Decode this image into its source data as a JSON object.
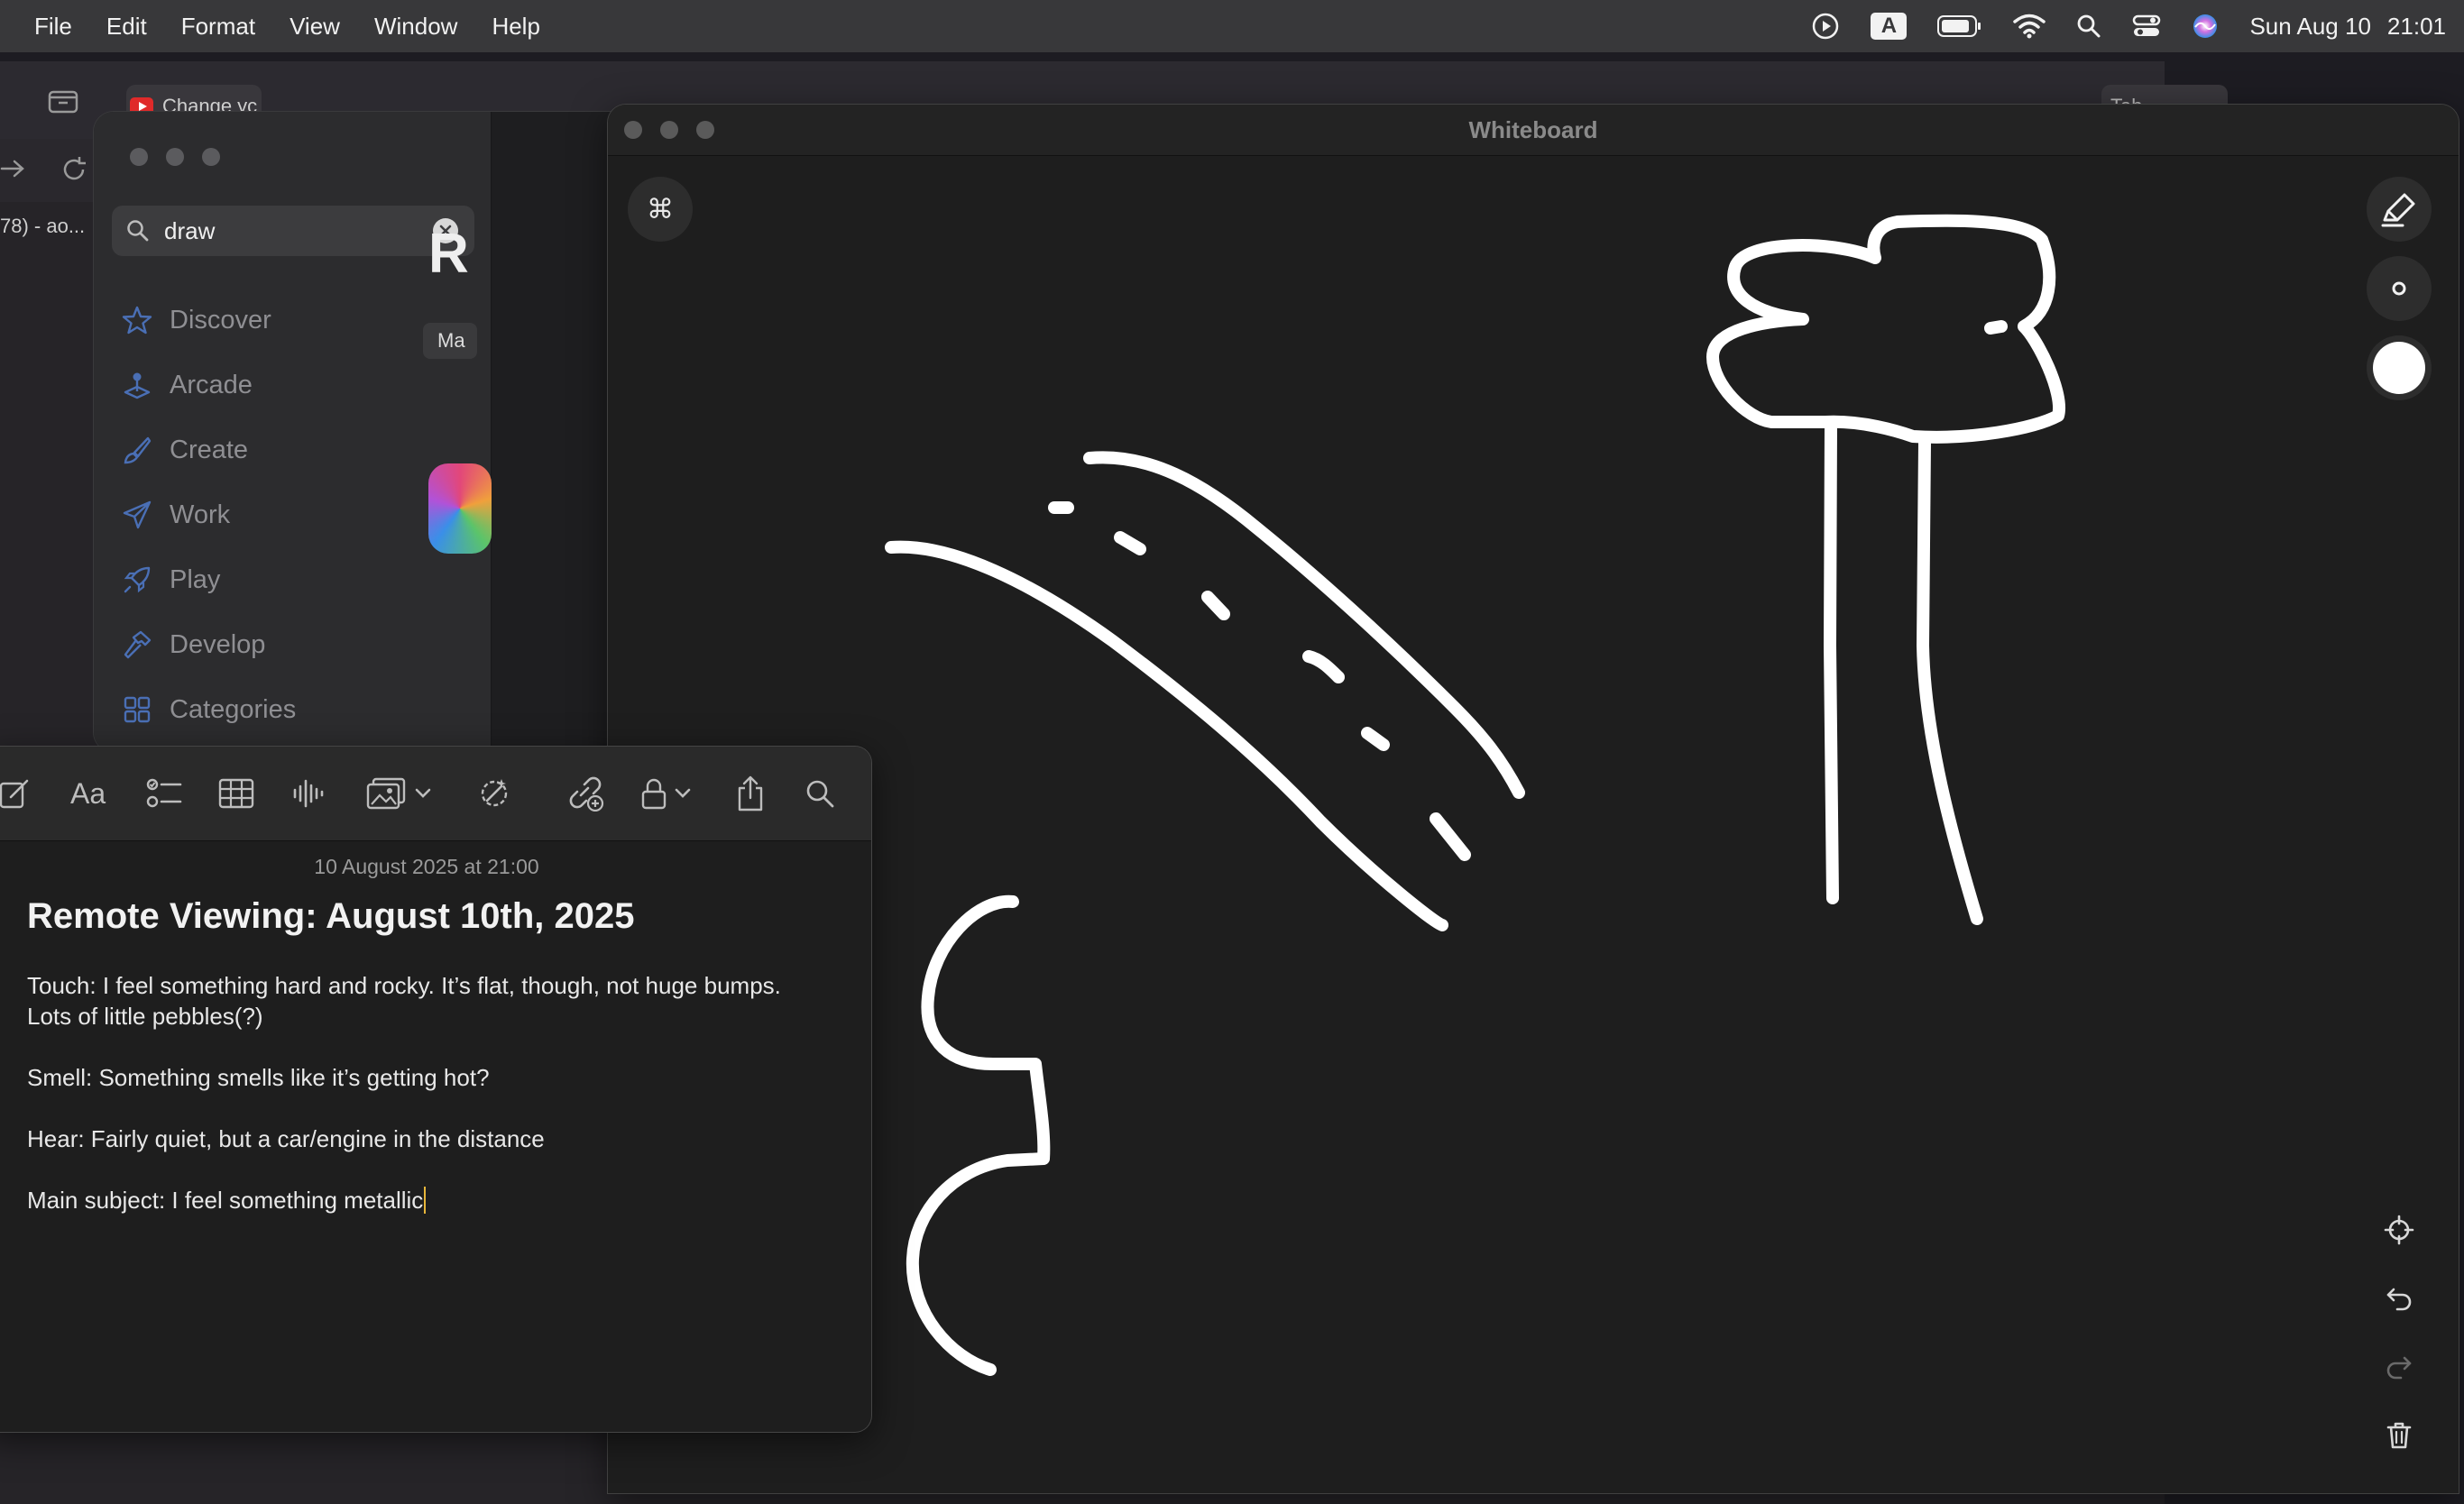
{
  "menubar": {
    "items": [
      "File",
      "Edit",
      "Format",
      "View",
      "Window",
      "Help"
    ],
    "input_source": "A",
    "clock": {
      "date": "Sun Aug 10",
      "time": "21:01"
    }
  },
  "browser": {
    "tab_title": "Change yc",
    "right_tab_title": "Tab",
    "sidebar_tab_text": "78) - ao..."
  },
  "appstore": {
    "search": {
      "value": "draw"
    },
    "nav": [
      {
        "label": "Discover",
        "icon": "star-icon"
      },
      {
        "label": "Arcade",
        "icon": "joystick-icon"
      },
      {
        "label": "Create",
        "icon": "brush-icon"
      },
      {
        "label": "Work",
        "icon": "paperplane-icon"
      },
      {
        "label": "Play",
        "icon": "rocket-icon"
      },
      {
        "label": "Develop",
        "icon": "hammer-icon"
      },
      {
        "label": "Categories",
        "icon": "grid-icon"
      }
    ],
    "main_heading_partial": "R",
    "main_pill_partial": "Ma"
  },
  "whiteboard": {
    "title": "Whiteboard",
    "command_icon": "⌘",
    "pen_color": "#ffffff",
    "tools": [
      "highlighter-icon",
      "brush-size-icon",
      "color-swatch-icon"
    ],
    "bottom_tools": [
      "recenter-icon",
      "undo-icon",
      "redo-icon",
      "trash-icon"
    ]
  },
  "notes": {
    "date": "10 August 2025 at 21:00",
    "title": "Remote Viewing: August 10th, 2025",
    "lines": [
      "Touch: I feel something hard and rocky. It’s flat, though, not huge bumps.",
      "Lots of little pebbles(?)",
      "Smell: Something smells like it’s getting hot?",
      "Hear: Fairly quiet, but a car/engine in the distance",
      "Main subject: I feel something metallic"
    ],
    "caret_color": "#e7b63a",
    "toolbar_items": [
      "compose-icon",
      "text-format-icon",
      "checklist-icon",
      "table-icon",
      "audio-icon",
      "media-icon",
      "chevron-down-icon",
      "writing-tools-icon",
      "collaborate-icon",
      "lock-icon",
      "chevron-down-icon",
      "share-icon",
      "search-icon"
    ]
  }
}
